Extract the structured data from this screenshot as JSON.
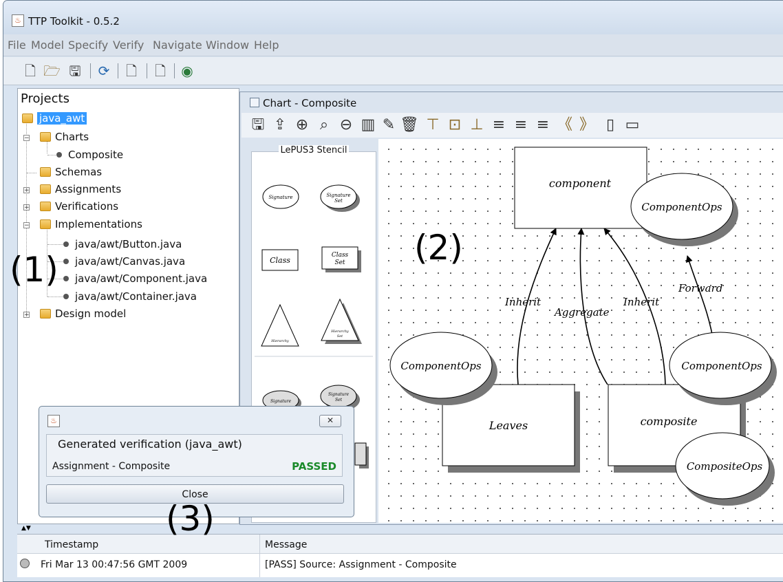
{
  "window": {
    "title": "TTP Toolkit - 0.5.2"
  },
  "menu": [
    "File",
    "Model",
    "Specify",
    "Verify",
    "Navigate",
    "Window",
    "Help"
  ],
  "projects": {
    "header": "Projects",
    "root": "java_awt",
    "charts": "Charts",
    "composite": "Composite",
    "schemas": "Schemas",
    "assignments": "Assignments",
    "verifications": "Verifications",
    "implementations": "Implementations",
    "files": [
      "java/awt/Button.java",
      "java/awt/Canvas.java",
      "java/awt/Component.java",
      "java/awt/Container.java"
    ],
    "design_model": "Design model"
  },
  "annotations": {
    "a1": "(1)",
    "a2": "(2)",
    "a3": "(3)"
  },
  "chart": {
    "title": "Chart - Composite",
    "stencil_label": "LePUS3 Stencil",
    "stencil_items": [
      "Signature",
      "Signature Set",
      "Class",
      "Class Set",
      "Hierarchy",
      "Hierarchy Set",
      "Signature",
      "Signature Set"
    ],
    "diagram": {
      "component": "component",
      "component_ops_top": "ComponentOps",
      "leaves": "Leaves",
      "composite": "composite",
      "component_ops_left": "ComponentOps",
      "component_ops_right": "ComponentOps",
      "composite_ops": "CompositeOps",
      "inherit_left": "Inherit",
      "aggregate": "Aggregate",
      "inherit_right": "Inherit",
      "forward": "Forward"
    }
  },
  "dialog": {
    "group_title": "Generated verification (java_awt)",
    "assignment": "Assignment - Composite",
    "status": "PASSED",
    "status_color": "#1a8a2a",
    "close_label": "Close",
    "close_x": "✕"
  },
  "log": {
    "columns": [
      "Timestamp",
      "Message"
    ],
    "rows": [
      {
        "timestamp": "Fri Mar 13 00:47:56 GMT 2009",
        "message": "[PASS] Source: Assignment - Composite"
      }
    ]
  }
}
